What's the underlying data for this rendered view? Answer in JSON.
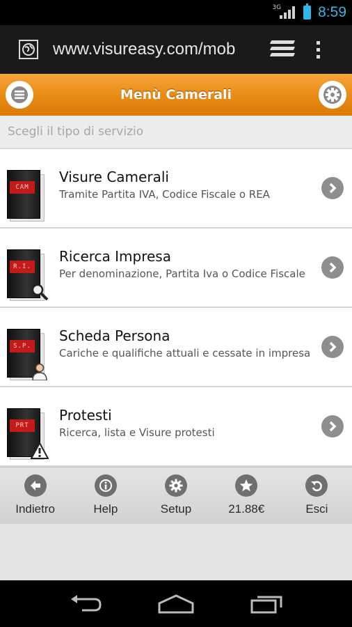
{
  "status_bar": {
    "network": "3G",
    "time": "8:59"
  },
  "browser": {
    "url": "www.visureasy.com/mob"
  },
  "header": {
    "title": "Menù Camerali"
  },
  "subheader": {
    "text": "Scegli il tipo di servizio"
  },
  "menu": [
    {
      "title": "Visure Camerali",
      "description": "Tramite Partita IVA, Codice Fiscale o REA",
      "tag": "CAM",
      "badge": "none"
    },
    {
      "title": "Ricerca Impresa",
      "description": "Per denominazione, Partita Iva o Codice Fiscale",
      "tag": "R.I.",
      "badge": "magnifier-icon"
    },
    {
      "title": "Scheda Persona",
      "description": "Cariche e qualifiche attuali e cessate in impresa",
      "tag": "S.P.",
      "badge": "person-icon"
    },
    {
      "title": "Protesti",
      "description": "Ricerca, lista e Visure protesti",
      "tag": "PRT",
      "badge": "warning-icon"
    }
  ],
  "toolbar": [
    {
      "label": "Indietro",
      "icon": "back-arrow-icon"
    },
    {
      "label": "Help",
      "icon": "info-icon"
    },
    {
      "label": "Setup",
      "icon": "gear-icon"
    },
    {
      "label": "21.88€",
      "icon": "star-icon"
    },
    {
      "label": "Esci",
      "icon": "exit-icon"
    }
  ],
  "colors": {
    "accent": "#e98a13",
    "status_blue": "#33b5e5",
    "chevron": "#8e8e8e"
  }
}
